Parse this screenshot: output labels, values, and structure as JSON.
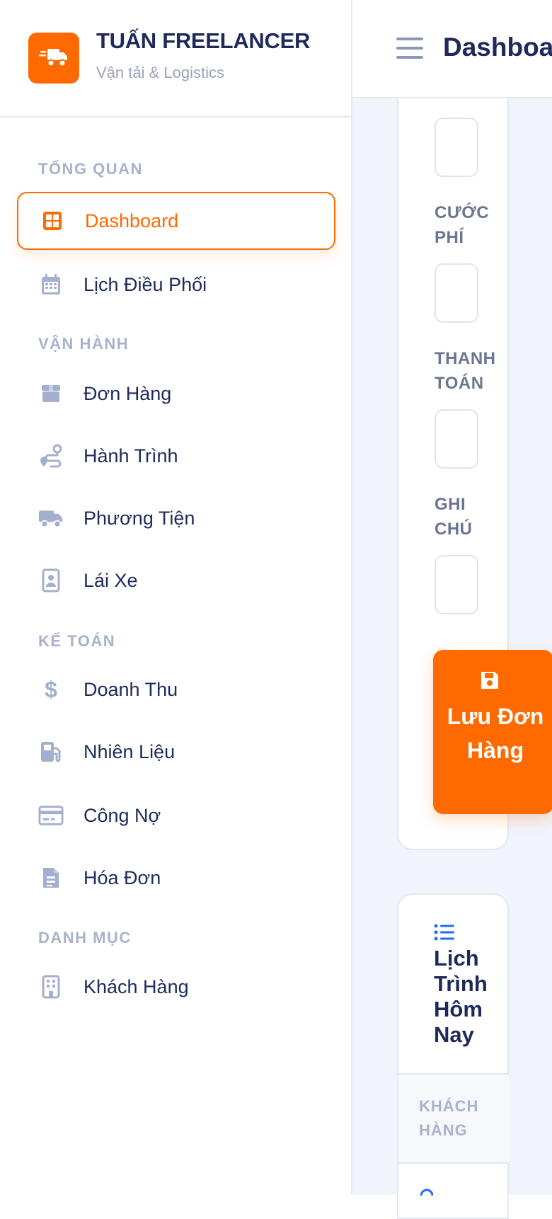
{
  "brand": {
    "name": "TUẤN FREELANCER",
    "subtitle": "Vận tải & Logistics",
    "accent_color": "#ff6a00"
  },
  "sidebar": {
    "sections": [
      {
        "label": "TỔNG QUAN",
        "items": [
          {
            "label": "Dashboard",
            "icon": "grid-icon",
            "active": true
          },
          {
            "label": "Lịch Điều Phối",
            "icon": "calendar-icon"
          }
        ]
      },
      {
        "label": "VẬN HÀNH",
        "items": [
          {
            "label": "Đơn Hàng",
            "icon": "box-icon"
          },
          {
            "label": "Hành Trình",
            "icon": "route-icon"
          },
          {
            "label": "Phương Tiện",
            "icon": "truck-icon"
          },
          {
            "label": "Lái Xe",
            "icon": "id-badge-icon"
          }
        ]
      },
      {
        "label": "KẾ TOÁN",
        "items": [
          {
            "label": "Doanh Thu",
            "icon": "dollar-icon"
          },
          {
            "label": "Nhiên Liệu",
            "icon": "gas-pump-icon"
          },
          {
            "label": "Công Nợ",
            "icon": "credit-card-icon"
          },
          {
            "label": "Hóa Đơn",
            "icon": "invoice-icon"
          }
        ]
      },
      {
        "label": "DANH MỤC",
        "items": [
          {
            "label": "Khách Hàng",
            "icon": "building-icon"
          }
        ]
      }
    ]
  },
  "header": {
    "title": "Dashboard"
  },
  "order_form": {
    "fields": [
      {
        "label": "CƯỚC PHÍ",
        "value": ""
      },
      {
        "label": "THANH TOÁN",
        "value": ""
      },
      {
        "label": "GHI CHÚ",
        "value": ""
      }
    ],
    "save_button": "Lưu Đơn Hàng"
  },
  "schedule": {
    "title": "Lịch Trình Hôm Nay",
    "columns": [
      "KHÁCH HÀNG"
    ]
  }
}
